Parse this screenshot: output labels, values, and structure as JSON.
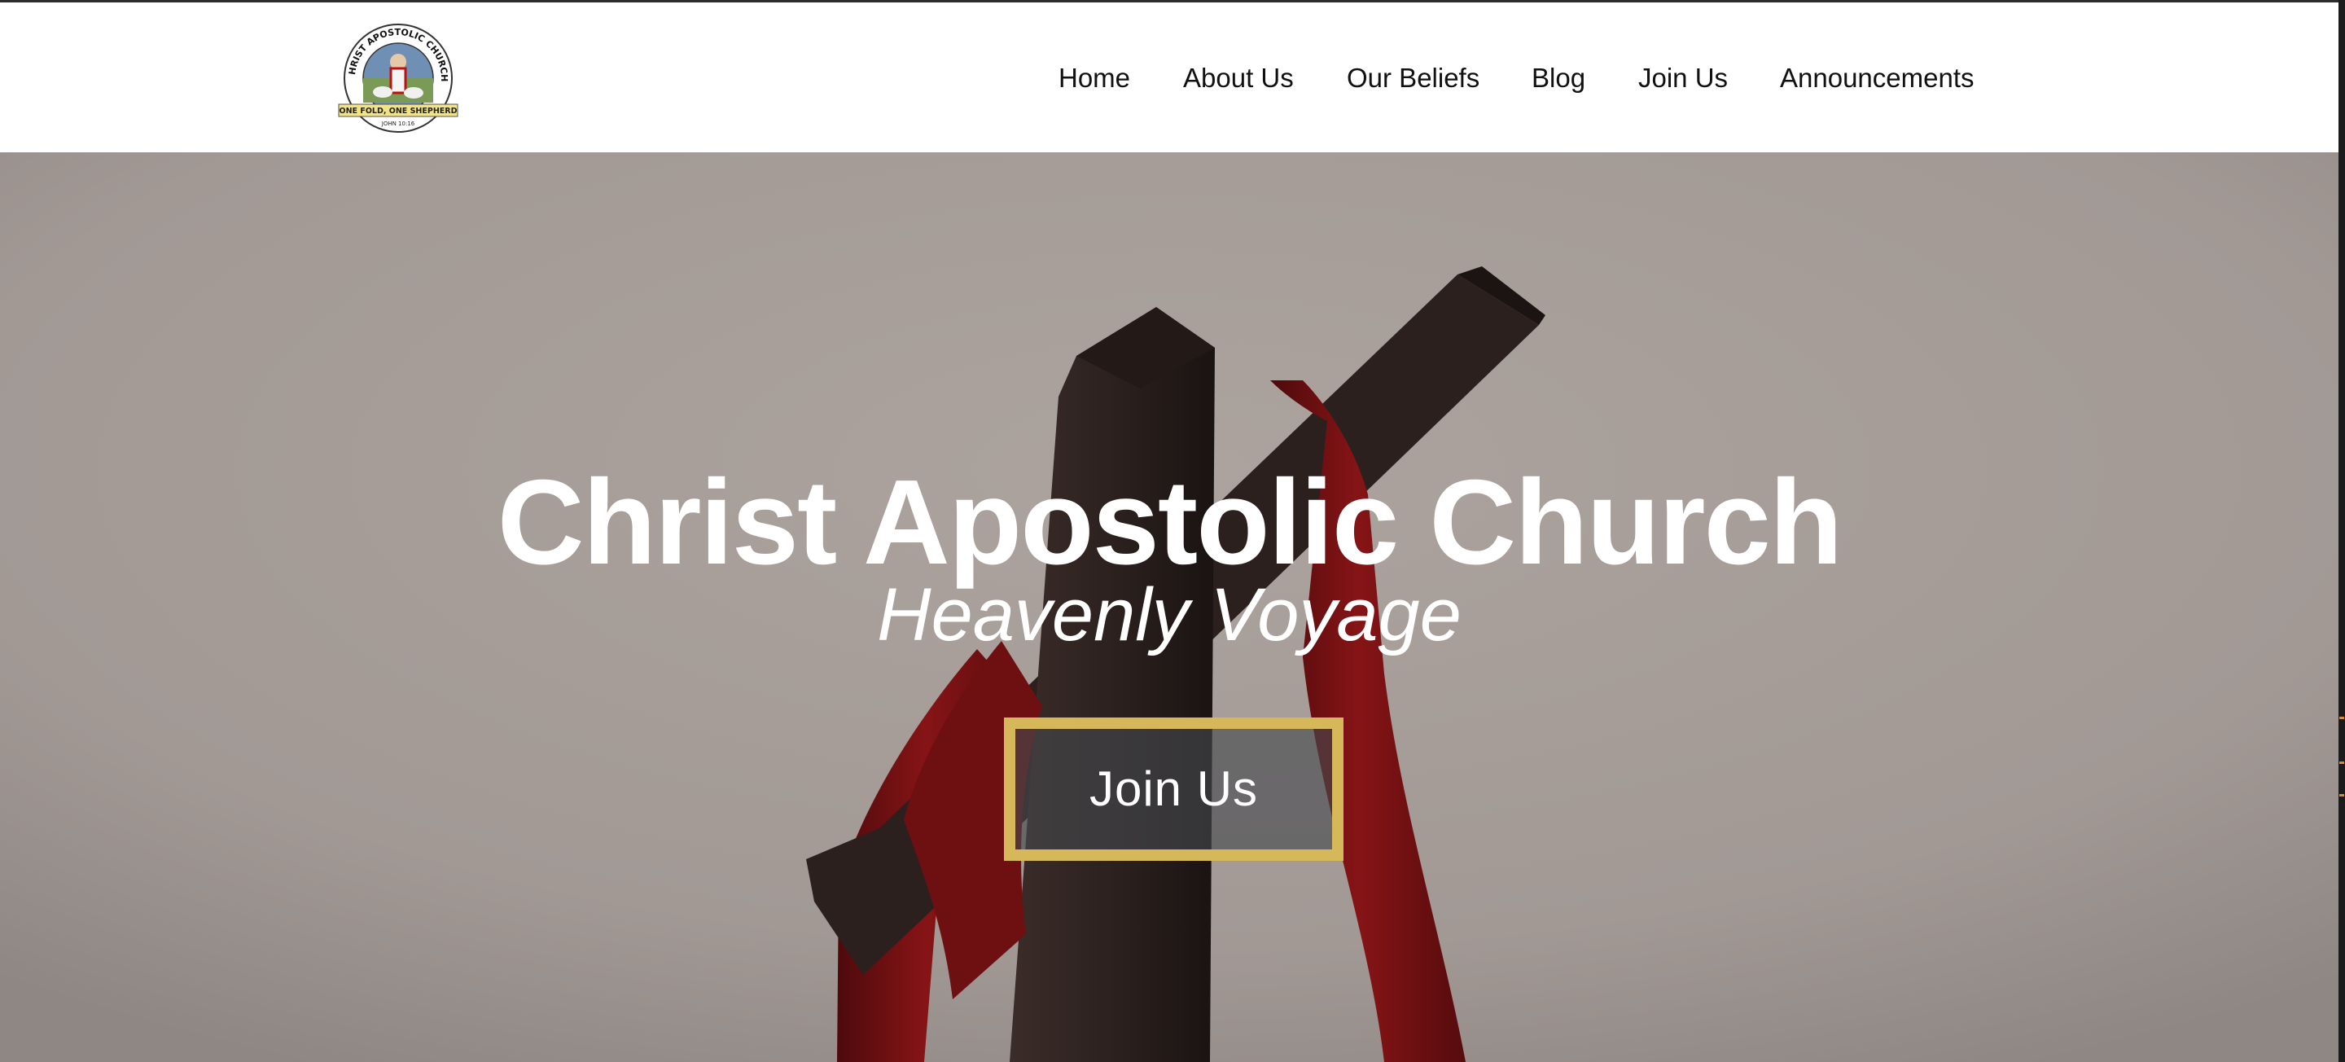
{
  "site": {
    "logo": {
      "ring_text": "CHRIST APOSTOLIC CHURCH",
      "banner_text": "ONE FOLD, ONE SHEPHERD",
      "verse_text": "JOHN 10:16"
    }
  },
  "nav": {
    "items": [
      {
        "label": "Home"
      },
      {
        "label": "About Us"
      },
      {
        "label": "Our Beliefs"
      },
      {
        "label": "Blog"
      },
      {
        "label": "Join Us"
      },
      {
        "label": "Announcements"
      }
    ]
  },
  "hero": {
    "title": "Christ Apostolic Church",
    "subtitle": "Heavenly Voyage",
    "cta_label": "Join Us"
  },
  "colors": {
    "accent_gold": "#d6b759",
    "sash_red": "#7a0f12",
    "cross_wood": "#2e2220",
    "sky": "#a49c97"
  }
}
